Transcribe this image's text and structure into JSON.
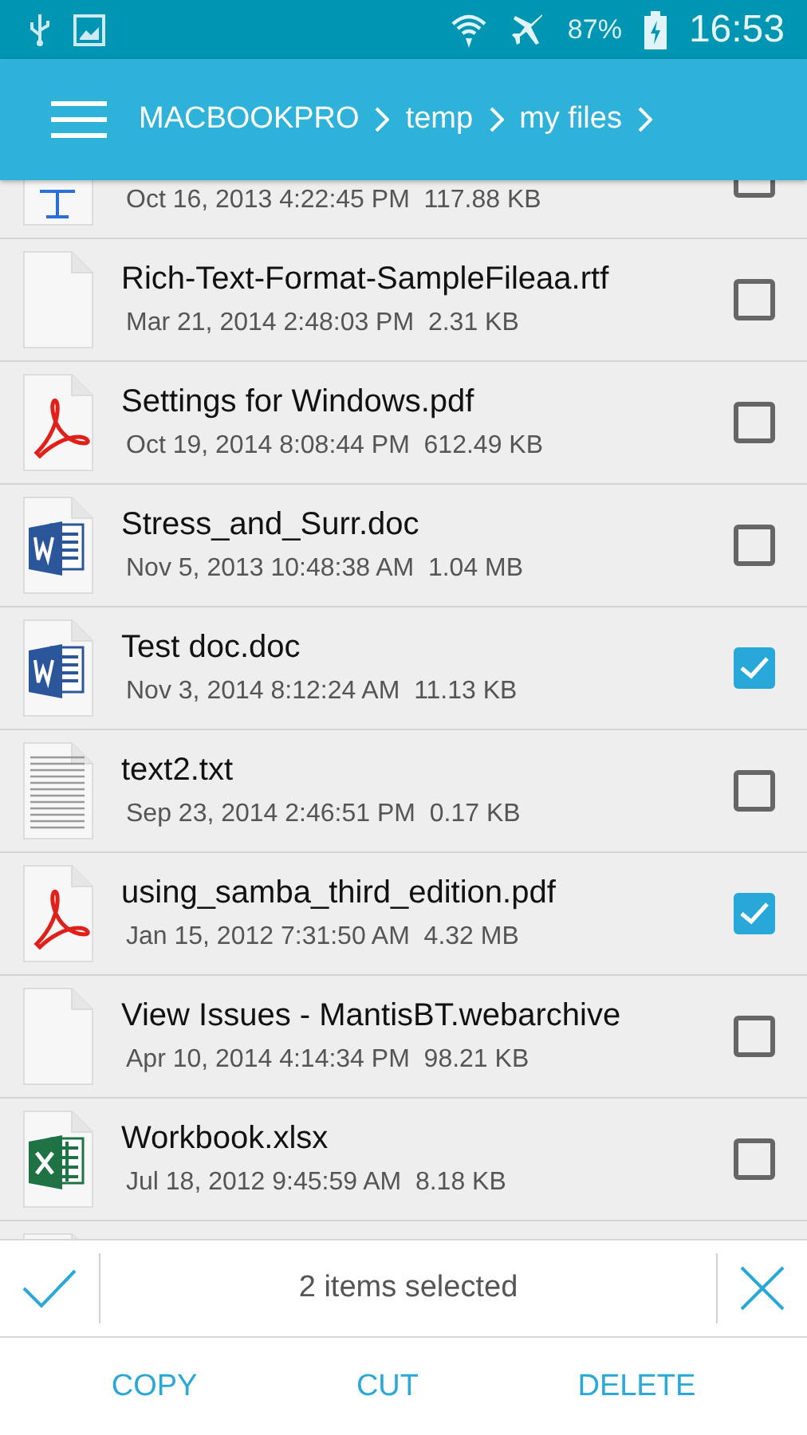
{
  "status_bar": {
    "battery": "87%",
    "time": "16:53"
  },
  "breadcrumb": [
    "MACBOOKPRO",
    "temp",
    "my files"
  ],
  "files": [
    {
      "kind": "keynote",
      "cut_top": true,
      "meta": "Oct 16, 2013 4:22:45 PM  117.88 KB"
    },
    {
      "kind": "blank",
      "name": "Rich-Text-Format-SampleFileaa.rtf",
      "meta": "Mar 21, 2014 2:48:03 PM  2.31 KB",
      "checked": false
    },
    {
      "kind": "pdf",
      "name": "Settings for Windows.pdf",
      "meta": "Oct 19, 2014 8:08:44 PM  612.49 KB",
      "checked": false
    },
    {
      "kind": "word",
      "name": "Stress_and_Surr.doc",
      "meta": "Nov 5, 2013 10:48:38 AM  1.04 MB",
      "checked": false
    },
    {
      "kind": "word",
      "name": "Test doc.doc",
      "meta": "Nov 3, 2014 8:12:24 AM  11.13 KB",
      "checked": true
    },
    {
      "kind": "text",
      "name": "text2.txt",
      "meta": "Sep 23, 2014 2:46:51 PM  0.17 KB",
      "checked": false
    },
    {
      "kind": "pdf",
      "name": "using_samba_third_edition.pdf",
      "meta": "Jan 15, 2012 7:31:50 AM  4.32 MB",
      "checked": true
    },
    {
      "kind": "blank",
      "name": "View Issues - MantisBT.webarchive",
      "meta": "Apr 10, 2014 4:14:34 PM  98.21 KB",
      "checked": false
    },
    {
      "kind": "excel",
      "name": "Workbook.xlsx",
      "meta": "Jul 18, 2012 9:45:59 AM  8.18 KB",
      "checked": false
    },
    {
      "kind": "blank",
      "cut_bottom": true
    }
  ],
  "selection": {
    "label": "2 items selected"
  },
  "actions": [
    "COPY",
    "CUT",
    "DELETE"
  ]
}
